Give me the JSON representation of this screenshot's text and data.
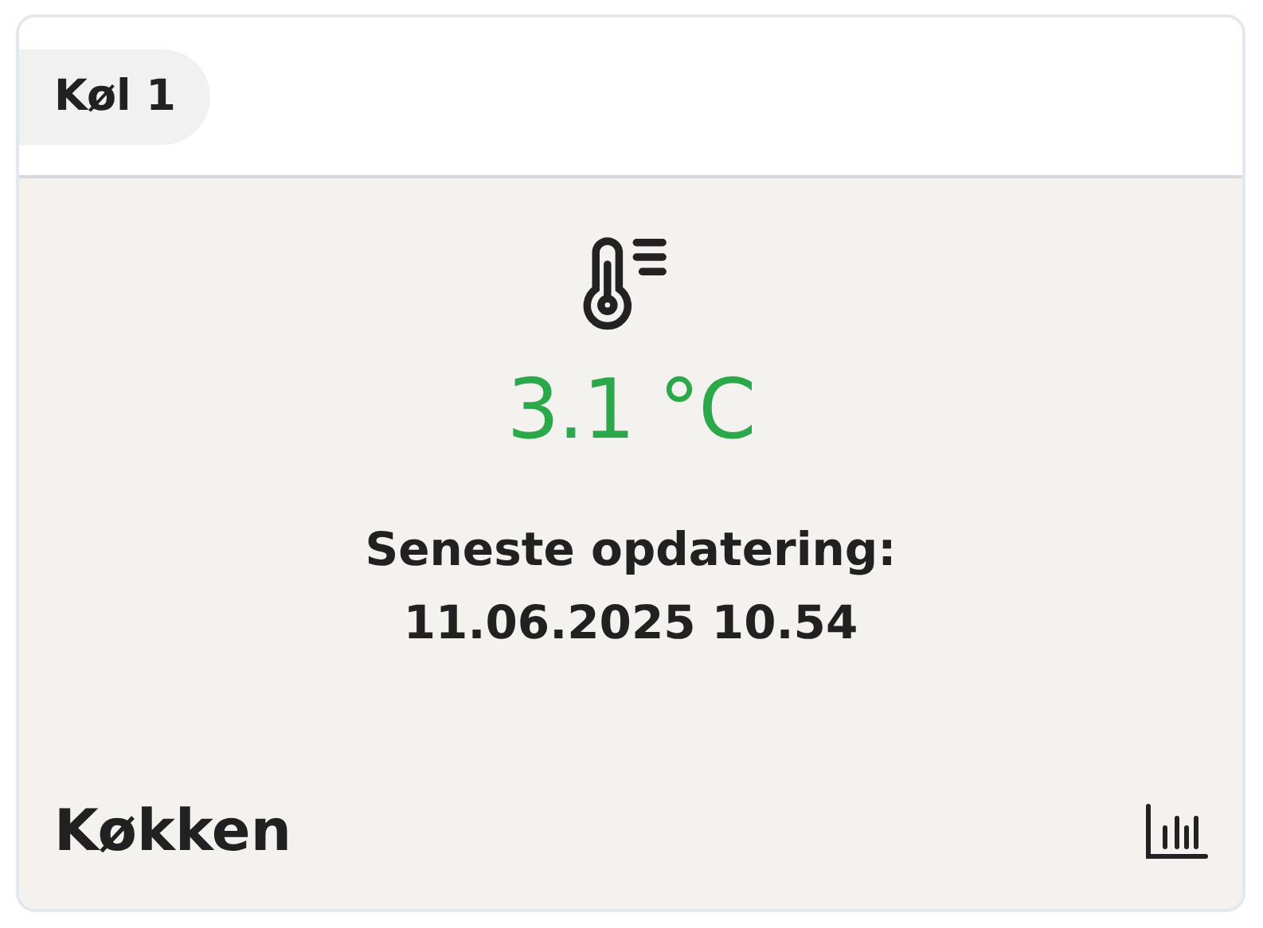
{
  "card": {
    "title": "Køl 1",
    "temperature": "3.1 °C",
    "update_label": "Seneste opdatering:",
    "update_time": "11.06.2025 10.54",
    "location": "Køkken"
  }
}
